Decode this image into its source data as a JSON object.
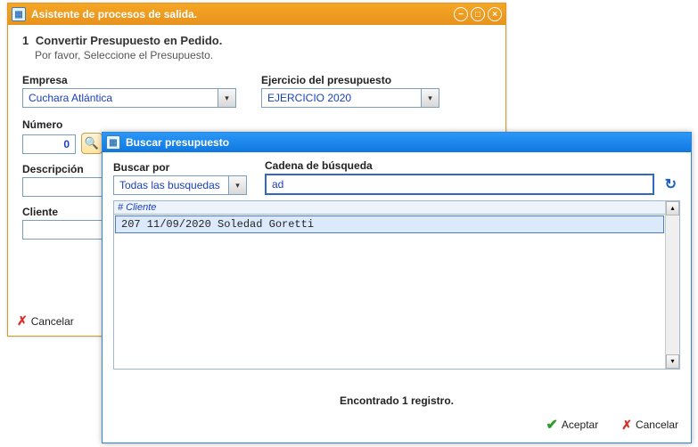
{
  "main_window": {
    "title": "Asistente de procesos de salida.",
    "step_number": "1",
    "step_title": "Convertir Presupuesto en Pedido.",
    "step_subtitle": "Por favor, Seleccione el Presupuesto.",
    "empresa": {
      "label": "Empresa",
      "value": "Cuchara Atlántica"
    },
    "ejercicio": {
      "label": "Ejercicio del presupuesto",
      "value": "EJERCICIO 2020"
    },
    "numero": {
      "label": "Número",
      "value": "0"
    },
    "descripcion": {
      "label": "Descripción",
      "value": ""
    },
    "cliente": {
      "label": "Cliente",
      "value": ""
    },
    "cancel_label": "Cancelar"
  },
  "search_window": {
    "title": "Buscar presupuesto",
    "buscar_por": {
      "label": "Buscar por",
      "value": "Todas las busquedas"
    },
    "cadena": {
      "label": "Cadena de búsqueda",
      "value": "ad"
    },
    "header": "# Cliente",
    "rows": [
      {
        "text": "   207 11/09/2020 Soledad Goretti"
      }
    ],
    "status": "Encontrado 1 registro.",
    "accept_label": "Aceptar",
    "cancel_label": "Cancelar"
  }
}
